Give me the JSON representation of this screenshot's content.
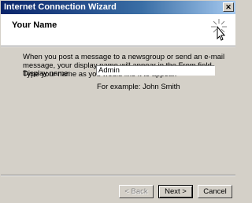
{
  "window": {
    "title": "Internet Connection Wizard",
    "close_glyph": "✕"
  },
  "header": {
    "title": "Your Name",
    "icon": "wizard-wand-icon"
  },
  "body": {
    "instructions": "When you post a message to a newsgroup or send an e-mail message, your display name will appear in the From field.  Type your name as you would like it to appear.",
    "display_name_label": "Display name:",
    "display_name_value": "Admin",
    "example": "For example: John Smith"
  },
  "buttons": {
    "back": "< Back",
    "next": "Next >",
    "cancel": "Cancel"
  }
}
